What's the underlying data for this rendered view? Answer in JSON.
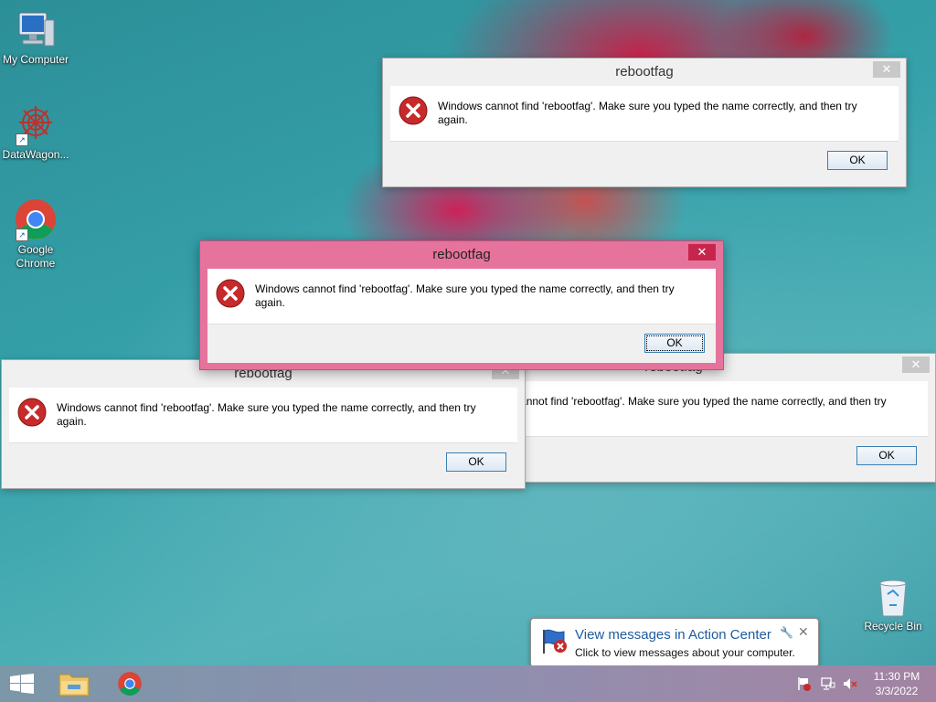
{
  "desktop_icons": [
    {
      "label": "My Computer"
    },
    {
      "label": "DataWagon..."
    },
    {
      "label": "Google Chrome"
    },
    {
      "label": "Recycle Bin"
    }
  ],
  "dialogs": [
    {
      "title": "rebootfag",
      "message": "Windows cannot find 'rebootfag'. Make sure you typed the name correctly, and then try again.",
      "ok_label": "OK",
      "close_label": "✕"
    },
    {
      "title": "rebootfag",
      "message": "Windows cannot find 'rebootfag'. Make sure you typed the name correctly, and then try again.",
      "ok_label": "OK",
      "close_label": "✕"
    },
    {
      "title": "rebootfag",
      "message": "Windows cannot find 'rebootfag'. Make sure you typed the name correctly, and then try again.",
      "ok_label": "OK",
      "close_label": "✕"
    },
    {
      "title": "rebootfag",
      "message": "Windows cannot find 'rebootfag'. Make sure you typed the name correctly, and then try again.",
      "ok_label": "OK",
      "close_label": "✕"
    }
  ],
  "notification": {
    "title": "View messages in Action Center",
    "subtitle": "Click to view messages about your computer.",
    "close_label": "✕"
  },
  "clock": {
    "time": "11:30 PM",
    "date": "3/3/2022"
  },
  "colors": {
    "active_dialog": "#e6739c",
    "close_red": "#c7264c",
    "accent_blue": "#1e5b9c"
  }
}
